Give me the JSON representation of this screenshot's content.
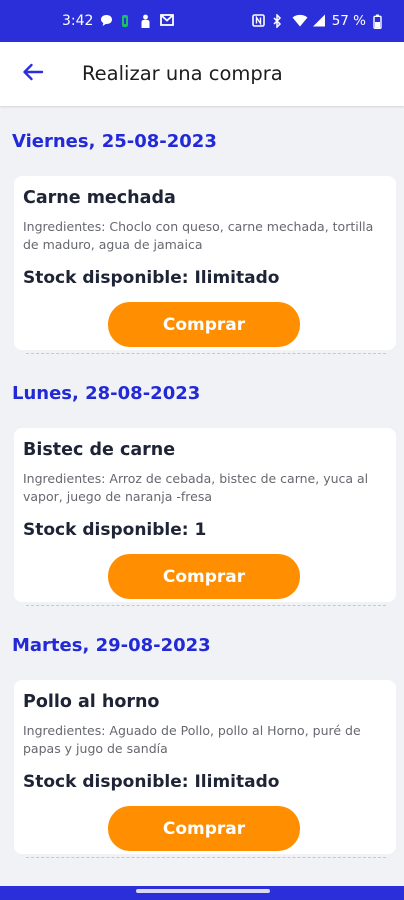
{
  "status_bar": {
    "time": "3:42",
    "battery": "57 %",
    "left_icons": [
      "chat-icon",
      "app-icon",
      "person-icon",
      "mail-icon"
    ],
    "right_icons": [
      "nfc-icon",
      "bluetooth-icon",
      "wifi-icon",
      "signal-icon",
      "battery-icon"
    ]
  },
  "app_bar": {
    "title": "Realizar una compra",
    "back_icon": "arrow-left-icon"
  },
  "days": [
    {
      "date": "Viernes, 25-08-2023",
      "dish": "Carne mechada",
      "ingredients": "Ingredientes: Choclo con queso, carne mechada, tortilla de maduro, agua de jamaica",
      "stock": "Stock disponible: Ilimitado",
      "button": "Comprar"
    },
    {
      "date": "Lunes, 28-08-2023",
      "dish": "Bistec de carne",
      "ingredients": "Ingredientes: Arroz de cebada, bistec de carne, yuca al vapor, juego de naranja -fresa",
      "stock": "Stock disponible: 1",
      "button": "Comprar"
    },
    {
      "date": "Martes, 29-08-2023",
      "dish": "Pollo al horno",
      "ingredients": "Ingredientes: Aguado de Pollo, pollo al Horno, puré de papas y jugo de sandía",
      "stock": "Stock disponible: Ilimitado",
      "button": "Comprar"
    }
  ],
  "colors": {
    "primary": "#2b2fd9",
    "date_text": "#2229d6",
    "button": "#ff8f00",
    "background": "#f1f2f6"
  }
}
